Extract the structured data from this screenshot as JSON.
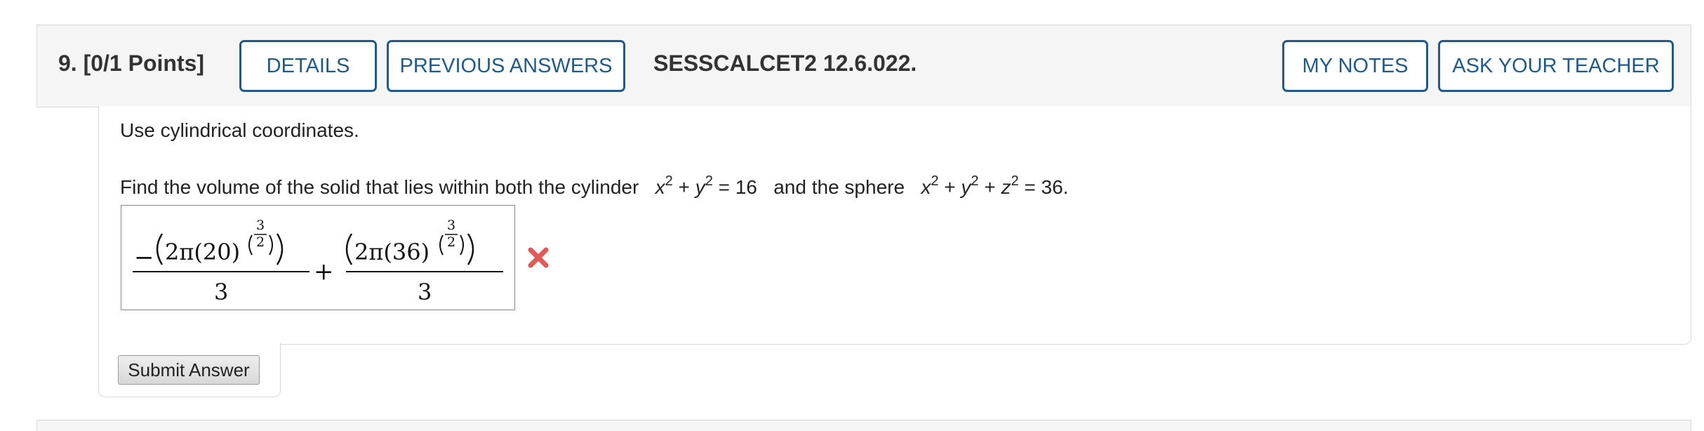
{
  "question": {
    "number": "9.",
    "points": "[0/1 Points]",
    "details_label": "DETAILS",
    "previous_answers_label": "PREVIOUS ANSWERS",
    "reference": "SESSCALCET2 12.6.022.",
    "my_notes_label": "MY NOTES",
    "ask_teacher_label": "ASK YOUR TEACHER"
  },
  "body": {
    "instruction": "Use cylindrical coordinates.",
    "prompt_start": "Find the volume of the solid that lies within both the cylinder",
    "cylinder_eq": {
      "x": "x",
      "x_exp": "2",
      "plus": " + ",
      "y": "y",
      "y_exp": "2",
      "rhs": " = 16"
    },
    "prompt_mid": "and the sphere",
    "sphere_eq": {
      "x": "x",
      "x_exp": "2",
      "y": "y",
      "y_exp": "2",
      "z": "z",
      "z_exp": "2",
      "rhs": " = 36."
    }
  },
  "answer": {
    "term1_numerator_sign": "−",
    "term1_base": "2π(20)",
    "term2_base": "2π(36)",
    "exponent_numerator": "3",
    "exponent_denominator": "2",
    "denominator": "3",
    "operator": "+",
    "status": "incorrect",
    "status_color": "#e05a5a"
  },
  "submit_label": "Submit Answer",
  "colors": {
    "accent": "#1f5a8a",
    "header_bg": "#f5f5f5",
    "border": "#d9d9d9"
  }
}
